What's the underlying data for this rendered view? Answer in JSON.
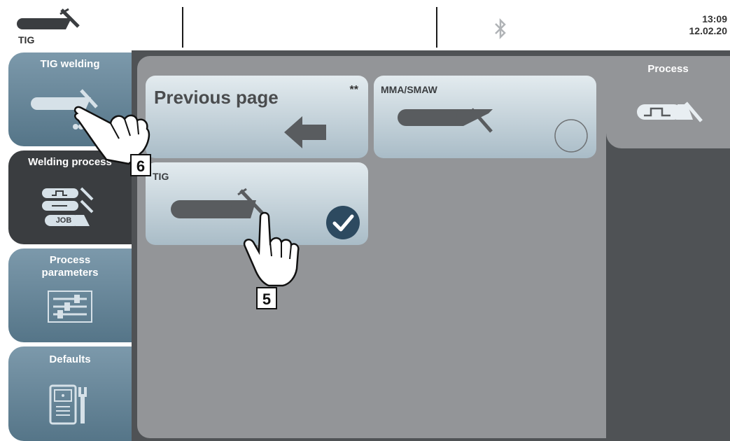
{
  "topbar": {
    "mode_label": "TIG",
    "time": "13:09",
    "date": "12.02.20",
    "icons": [
      "tig-torch-icon",
      "bluetooth-icon"
    ]
  },
  "sidebar": {
    "items": [
      {
        "label": "TIG welding",
        "icon": "tig-torch-icon"
      },
      {
        "label": "Welding process",
        "icon": "process-list-icon"
      },
      {
        "label": "Process parameters",
        "icon": "sliders-icon"
      },
      {
        "label": "Defaults",
        "icon": "machine-wrench-icon"
      }
    ],
    "job_label": "JOB"
  },
  "main": {
    "cards": [
      {
        "title": "Previous page",
        "marker": "**",
        "icon": "arrow-left-icon"
      },
      {
        "title": "MMA/SMAW",
        "icon": "electrode-holder-icon",
        "selected": false
      },
      {
        "title": "TIG",
        "icon": "tig-torch-icon",
        "selected": true
      }
    ]
  },
  "process": {
    "title": "Process",
    "icon": "pulse-torch-icon"
  },
  "callouts": [
    "6",
    "5"
  ]
}
